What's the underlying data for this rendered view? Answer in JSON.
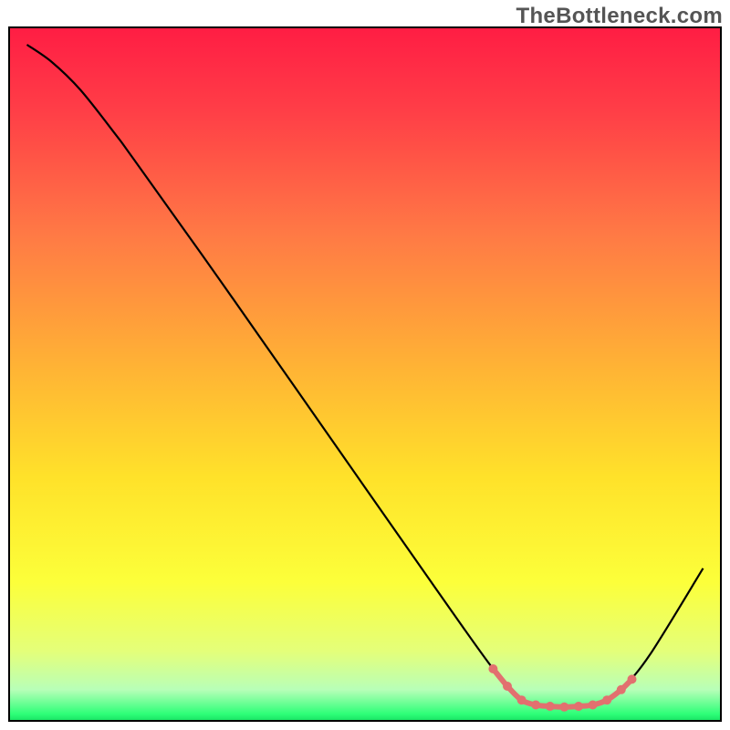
{
  "watermark": "TheBottleneck.com",
  "chart_data": {
    "type": "line",
    "title": "",
    "xlabel": "",
    "ylabel": "",
    "xlim": [
      0,
      100
    ],
    "ylim": [
      0,
      100
    ],
    "gradient_stops": [
      {
        "offset": 0.0,
        "color": "#ff1d44"
      },
      {
        "offset": 0.12,
        "color": "#ff3e47"
      },
      {
        "offset": 0.3,
        "color": "#ff7a45"
      },
      {
        "offset": 0.5,
        "color": "#ffb634"
      },
      {
        "offset": 0.65,
        "color": "#ffe22a"
      },
      {
        "offset": 0.8,
        "color": "#fcff3a"
      },
      {
        "offset": 0.9,
        "color": "#e4ff7a"
      },
      {
        "offset": 0.955,
        "color": "#b8ffb8"
      },
      {
        "offset": 0.99,
        "color": "#2eff78"
      },
      {
        "offset": 1.0,
        "color": "#18e263"
      }
    ],
    "series": [
      {
        "name": "bottleneck-curve",
        "color": "#000000",
        "x": [
          2.5,
          6,
          10,
          15,
          17.5,
          30,
          45,
          60,
          68,
          72,
          74,
          76,
          80,
          82,
          84,
          86,
          90,
          97.5
        ],
        "y": [
          97.5,
          95,
          91,
          84.5,
          81,
          63,
          41,
          19,
          7.5,
          3,
          2.3,
          2.1,
          2.1,
          2.3,
          3,
          4.5,
          9.5,
          22
        ]
      },
      {
        "name": "optimal-zone-marker",
        "color": "#e2706f",
        "x": [
          68,
          70,
          72,
          74,
          76,
          78,
          80,
          82,
          84,
          86,
          87.5
        ],
        "y": [
          7.5,
          5,
          3,
          2.3,
          2.1,
          2.0,
          2.1,
          2.3,
          3,
          4.5,
          6
        ]
      }
    ]
  }
}
